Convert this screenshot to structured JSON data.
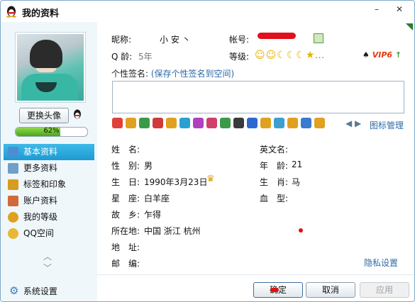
{
  "window": {
    "title": "我的资料",
    "min_label": "–",
    "close_label": "✕"
  },
  "left": {
    "change_avatar_label": "更换头像",
    "progress_text": "62%",
    "progress_value": 0.62,
    "nav": [
      {
        "label": "基本资料",
        "active": true,
        "icon": "card-icon",
        "color": "#4a8fd4"
      },
      {
        "label": "更多资料",
        "active": false,
        "icon": "list-icon",
        "color": "#6fa0c8"
      },
      {
        "label": "标签和印象",
        "active": false,
        "icon": "tag-icon",
        "color": "#d89c22"
      },
      {
        "label": "账户资料",
        "active": false,
        "icon": "account-icon",
        "color": "#d06a3a"
      },
      {
        "label": "我的等级",
        "active": false,
        "icon": "level-icon",
        "color": "#e0a020"
      },
      {
        "label": "QQ空间",
        "active": false,
        "icon": "qzone-icon",
        "color": "#e8b830"
      }
    ],
    "scroll_up": "︿",
    "scroll_down": "﹀",
    "system_settings_label": "系统设置"
  },
  "profile": {
    "nickname_label": "昵称:",
    "nickname_value": "小 安 丶",
    "account_label": "帐号:",
    "qage_label": "Q 龄:",
    "qage_value": "5年",
    "level_label": "等级:",
    "level_icons": "☺☺☾☾☾★",
    "level_more": "...",
    "vip_label": "VIP6",
    "vip_arrow": "↑",
    "signature_label": "个性签名:",
    "signature_link": "(保存个性签名到空间)",
    "signature_value": "",
    "icon_manage_label": "图标管理",
    "icons_nav": "◀ ▶",
    "name_label": "姓　名:",
    "name_value": "",
    "english_name_label": "英文名:",
    "english_name_value": "",
    "gender_label": "性　别:",
    "gender_value": "男",
    "age_label": "年　龄:",
    "age_value": "21",
    "birthday_label": "生　日:",
    "birthday_value": "1990年3月23日",
    "zodiac_label": "生　肖:",
    "zodiac_value": "马",
    "star_sign_label": "星　座:",
    "star_sign_value": "白羊座",
    "blood_type_label": "血　型:",
    "blood_type_value": "",
    "hometown_label": "故　乡:",
    "hometown_value": "乍得",
    "location_label": "所在地:",
    "location_value": "中国  浙江  杭州",
    "address_label": "地　址:",
    "address_value": "",
    "postcode_label": "邮　编:",
    "postcode_value": "",
    "privacy_label": "隐私设置"
  },
  "buttons": {
    "ok": "确定",
    "cancel": "取消",
    "apply": "应用"
  },
  "mini_icon_colors": [
    "#e0403a",
    "#e0a020",
    "#3a9a4a",
    "#d03a3a",
    "#e0a020",
    "#2aa0d0",
    "#b040c0",
    "#d0406a",
    "#3a9a4a",
    "#3a3a3a",
    "#2a6ad0",
    "#e0a020",
    "#3aa0d0",
    "#e0a020",
    "#3a7ad0",
    "#e0a020"
  ]
}
